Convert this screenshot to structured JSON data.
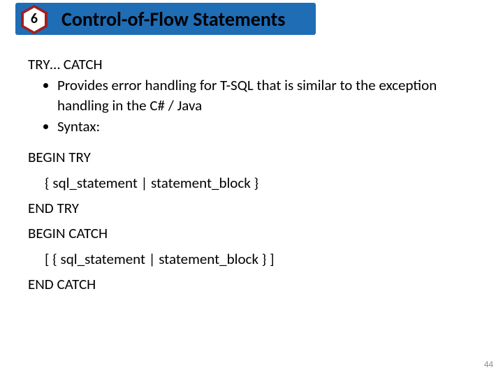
{
  "header": {
    "section_number": "6",
    "title": "Control-of-Flow Statements"
  },
  "content": {
    "subheading": "TRY… CATCH",
    "bullets": [
      "Provides error handling for T-SQL that is similar to the exception handling in the C# / Java",
      "Syntax:"
    ],
    "syntax": {
      "begin_try": "BEGIN TRY",
      "try_body": "{ sql_statement | statement_block }",
      "end_try": "END TRY",
      "begin_catch": "BEGIN CATCH",
      "catch_body": "[ { sql_statement | statement_block } ]",
      "end_catch": "END CATCH"
    }
  },
  "page_number": "44"
}
